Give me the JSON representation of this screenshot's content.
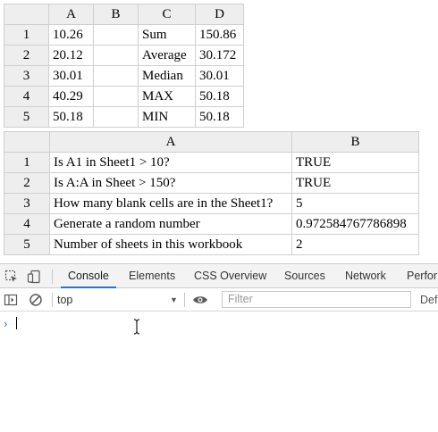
{
  "sheet1": {
    "col_headers": [
      "",
      "A",
      "B",
      "C",
      "D"
    ],
    "rows": [
      {
        "num": "1",
        "a": "10.26",
        "b": "",
        "c": "Sum",
        "d": "150.86"
      },
      {
        "num": "2",
        "a": "20.12",
        "b": "",
        "c": "Average",
        "d": "30.172"
      },
      {
        "num": "3",
        "a": "30.01",
        "b": "",
        "c": "Median",
        "d": "30.01"
      },
      {
        "num": "4",
        "a": "40.29",
        "b": "",
        "c": "MAX",
        "d": "50.18"
      },
      {
        "num": "5",
        "a": "50.18",
        "b": "",
        "c": "MIN",
        "d": "50.18"
      }
    ]
  },
  "sheet2": {
    "col_headers": [
      "",
      "A",
      "B"
    ],
    "rows": [
      {
        "num": "1",
        "a": "Is A1 in Sheet1 > 10?",
        "b": "TRUE"
      },
      {
        "num": "2",
        "a": "Is A:A in Sheet > 150?",
        "b": "TRUE"
      },
      {
        "num": "3",
        "a": "How many blank cells are in the Sheet1?",
        "b": "5"
      },
      {
        "num": "4",
        "a": "Generate a random number",
        "b": "0.972584767786898"
      },
      {
        "num": "5",
        "a": "Number of sheets in this workbook",
        "b": "2"
      }
    ]
  },
  "devtools": {
    "tabs": [
      "Console",
      "Elements",
      "CSS Overview",
      "Sources",
      "Network",
      "Perfor"
    ],
    "active_tab": "Console",
    "context": "top",
    "filter_placeholder": "Filter",
    "levels_label": "Defa",
    "icons": {
      "inspect": "inspect-element-icon",
      "device": "device-toolbar-icon",
      "sidebar": "sidebar-toggle-icon",
      "clear": "clear-console-icon",
      "eye": "live-expression-icon",
      "prompt": "prompt-chevron-icon"
    },
    "accent_color": "#1a73e8"
  }
}
